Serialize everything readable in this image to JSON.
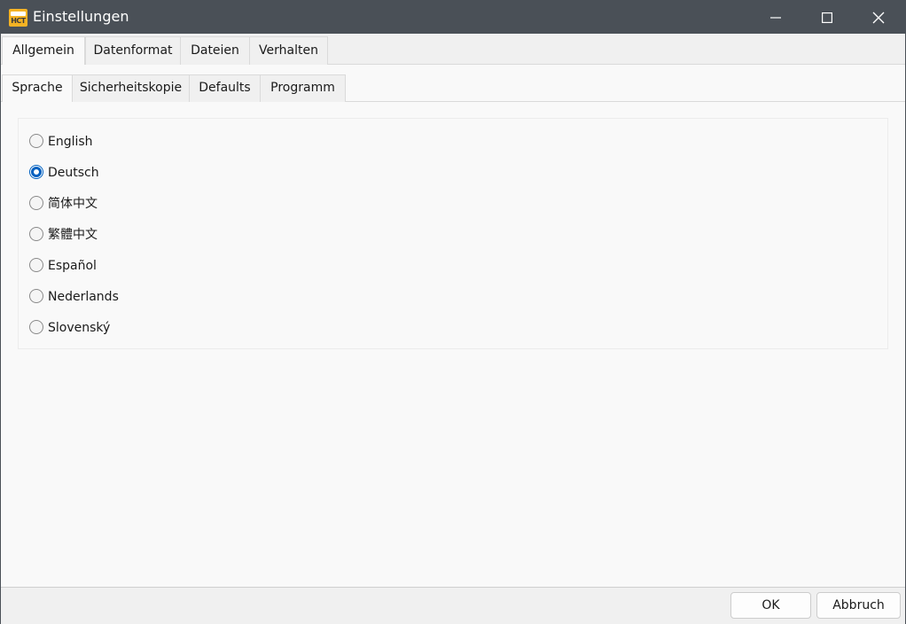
{
  "window": {
    "title": "Einstellungen",
    "icon": "app-logo-icon",
    "icon_text": "HCT"
  },
  "tabs_main": [
    {
      "label": "Allgemein",
      "active": true
    },
    {
      "label": "Datenformat",
      "active": false
    },
    {
      "label": "Dateien",
      "active": false
    },
    {
      "label": "Verhalten",
      "active": false
    }
  ],
  "tabs_sub": [
    {
      "label": "Sprache",
      "active": true
    },
    {
      "label": "Sicherheitskopie",
      "active": false
    },
    {
      "label": "Defaults",
      "active": false
    },
    {
      "label": "Programm",
      "active": false
    }
  ],
  "languages": [
    {
      "label": "English",
      "checked": false
    },
    {
      "label": "Deutsch",
      "checked": true
    },
    {
      "label": "简体中文",
      "checked": false
    },
    {
      "label": "繁體中文",
      "checked": false
    },
    {
      "label": "Español",
      "checked": false
    },
    {
      "label": "Nederlands",
      "checked": false
    },
    {
      "label": "Slovenský",
      "checked": false
    }
  ],
  "buttons": {
    "ok": "OK",
    "cancel": "Abbruch"
  },
  "colors": {
    "titlebar": "#4a5057",
    "accent": "#0060c0",
    "icon": "#f5b324"
  }
}
